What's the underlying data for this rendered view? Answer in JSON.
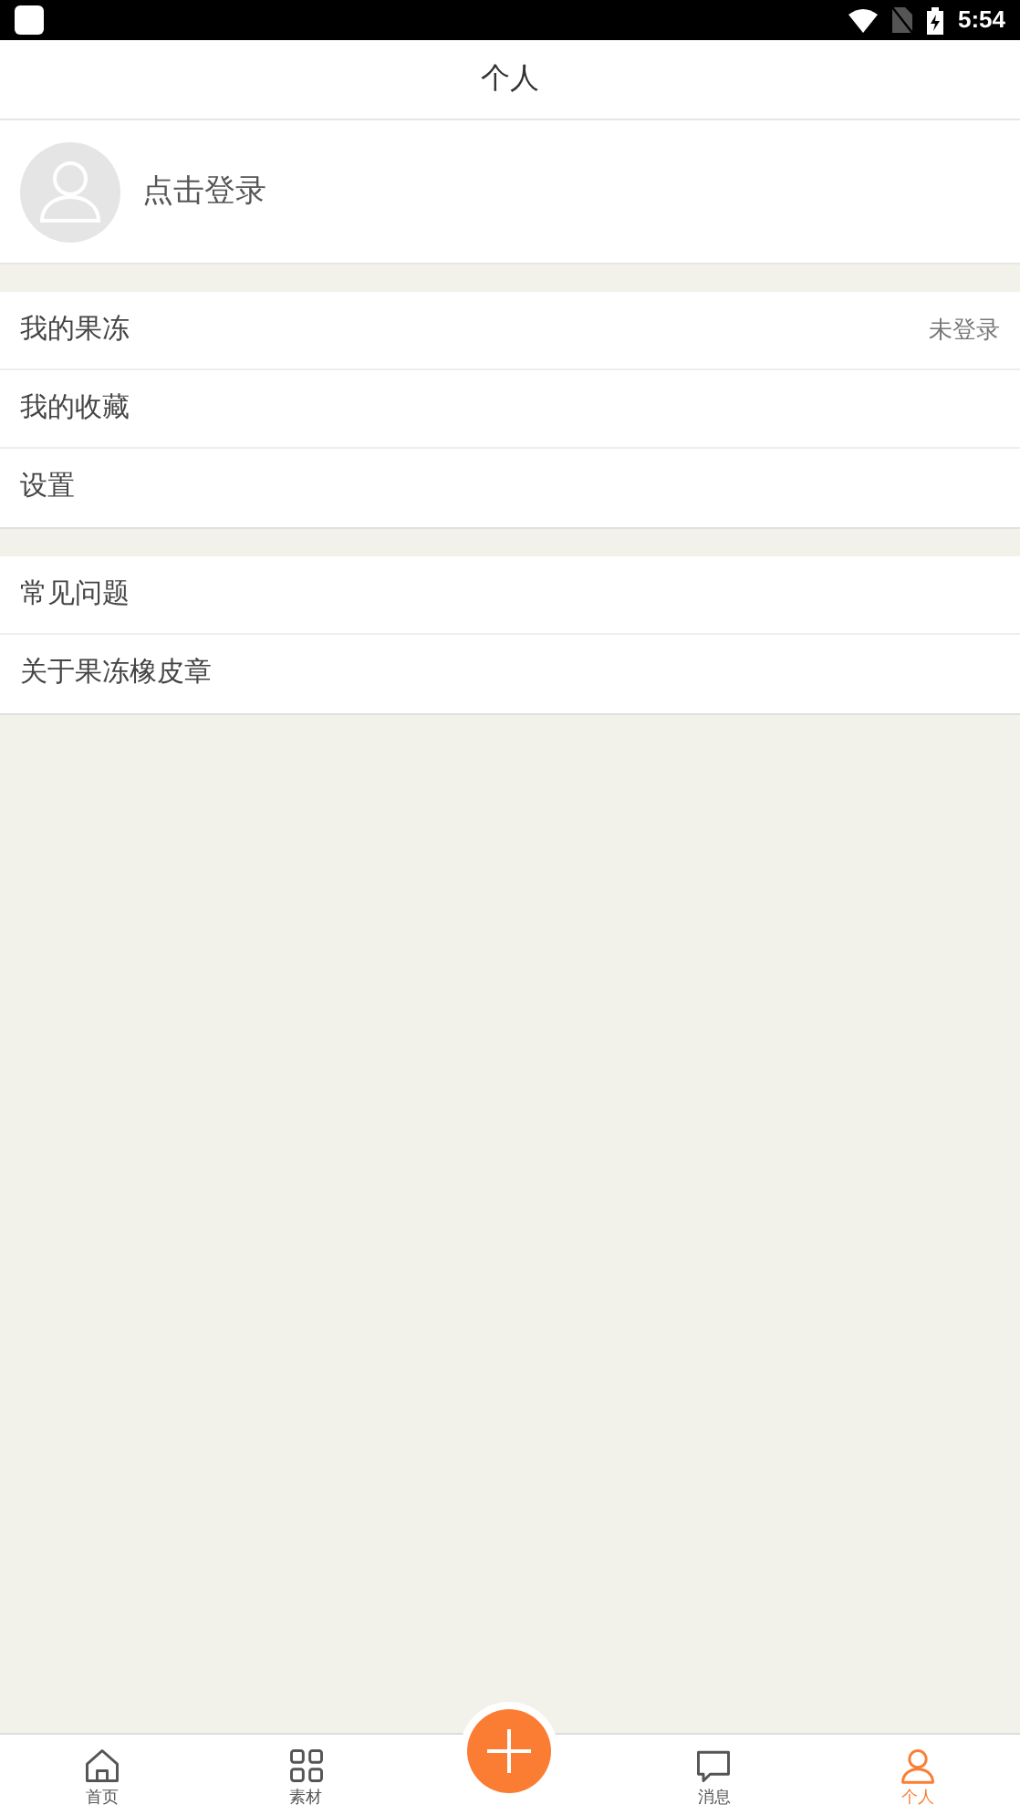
{
  "status_bar": {
    "time": "5:54"
  },
  "header": {
    "title": "个人"
  },
  "profile": {
    "login_label": "点击登录"
  },
  "menu_groups": [
    {
      "items": [
        {
          "label": "我的果冻",
          "value": "未登录"
        },
        {
          "label": "我的收藏"
        },
        {
          "label": "设置"
        }
      ]
    },
    {
      "items": [
        {
          "label": "常见问题"
        },
        {
          "label": "关于果冻橡皮章"
        }
      ]
    }
  ],
  "bottom_nav": [
    {
      "kind": "home",
      "label": "首页",
      "selected": false
    },
    {
      "kind": "grid",
      "label": "素材",
      "selected": false
    },
    {
      "kind": "add"
    },
    {
      "kind": "message",
      "label": "消息",
      "selected": false
    },
    {
      "kind": "person",
      "label": "个人",
      "selected": true
    }
  ]
}
